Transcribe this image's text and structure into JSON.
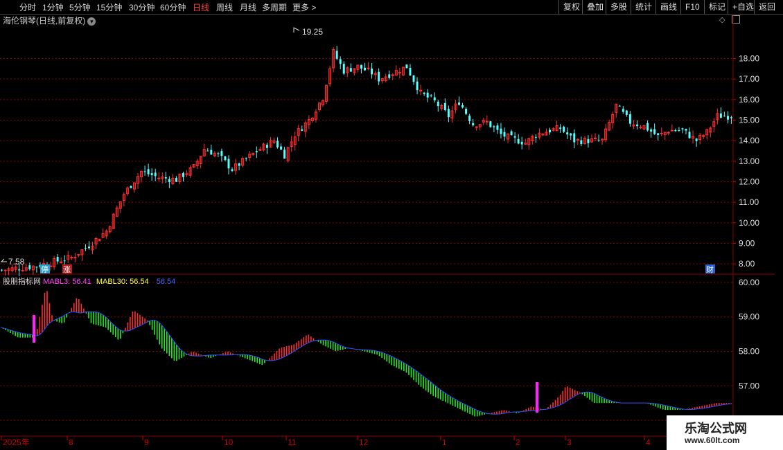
{
  "toolbar": {
    "periods": [
      "分时",
      "1分钟",
      "5分钟",
      "15分钟",
      "30分钟",
      "60分钟",
      "日线",
      "周线",
      "月线",
      "多周期",
      "更多"
    ],
    "active_period": "日线",
    "right_buttons": [
      "复权",
      "叠加",
      "多股",
      "统计",
      "画线",
      "F10",
      "标记",
      "+自选",
      "返回"
    ]
  },
  "chart": {
    "title": "海伦钢琴(日线,前复权)",
    "high_label": "19.25",
    "low_label": "7.58",
    "price_ticks": [
      "18.00",
      "17.00",
      "16.00",
      "15.00",
      "14.00",
      "13.00",
      "12.00",
      "11.00",
      "10.00",
      "9.00",
      "8.00"
    ],
    "markers": [
      "停",
      "涨",
      "财"
    ]
  },
  "indicator": {
    "name": "股朋指标网",
    "mabl3_label": "MABL3: 56.41",
    "mabl30_label": "MABL30: 56.54",
    "value_label": "56.54",
    "ticks": [
      "60.00",
      "59.00",
      "58.00",
      "57.00",
      "56.00"
    ]
  },
  "xaxis": {
    "labels": [
      "2025年",
      "8",
      "9",
      "10",
      "11",
      "12",
      "1",
      "2",
      "3",
      "4"
    ]
  },
  "watermark": {
    "line1": "乐淘公式网",
    "line2": "www.60lt.com"
  },
  "colors": {
    "up": "#ff3030",
    "down": "#54ffff",
    "mabl3": "#ff44ff",
    "mabl30": "#ffff44",
    "grid": "#8b0000",
    "green_bar": "#22ee22"
  },
  "chart_data": {
    "type": "candlestick+histogram",
    "price_ylim": [
      7.5,
      19.5
    ],
    "indicator_ylim": [
      55.9,
      60.2
    ],
    "close_path": [
      [
        0,
        7.7
      ],
      [
        10,
        7.9
      ],
      [
        20,
        8.3
      ],
      [
        25,
        8.9
      ],
      [
        30,
        9.6
      ],
      [
        35,
        11.4
      ],
      [
        40,
        12.5
      ],
      [
        45,
        12.2
      ],
      [
        50,
        12.1
      ],
      [
        55,
        12.7
      ],
      [
        58,
        13.6
      ],
      [
        62,
        13.3
      ],
      [
        66,
        12.6
      ],
      [
        70,
        13.1
      ],
      [
        74,
        13.6
      ],
      [
        78,
        14.0
      ],
      [
        81,
        13.3
      ],
      [
        84,
        14.3
      ],
      [
        88,
        15.0
      ],
      [
        92,
        16.1
      ],
      [
        95,
        18.3
      ],
      [
        98,
        17.4
      ],
      [
        102,
        17.6
      ],
      [
        106,
        17.3
      ],
      [
        108,
        17.0
      ],
      [
        112,
        17.3
      ],
      [
        116,
        17.6
      ],
      [
        120,
        16.3
      ],
      [
        124,
        15.9
      ],
      [
        128,
        15.2
      ],
      [
        131,
        15.9
      ],
      [
        135,
        14.8
      ],
      [
        139,
        14.9
      ],
      [
        143,
        14.3
      ],
      [
        146,
        14.1
      ],
      [
        150,
        13.9
      ],
      [
        153,
        14.3
      ],
      [
        157,
        14.5
      ],
      [
        160,
        14.6
      ],
      [
        164,
        14.0
      ],
      [
        168,
        14.0
      ],
      [
        172,
        14.0
      ],
      [
        176,
        15.7
      ],
      [
        180,
        14.9
      ],
      [
        184,
        14.7
      ],
      [
        188,
        14.2
      ],
      [
        191,
        14.5
      ],
      [
        195,
        14.5
      ],
      [
        199,
        14.0
      ],
      [
        202,
        14.4
      ],
      [
        205,
        15.2
      ]
    ],
    "indicator_bars": [
      [
        0,
        58.7
      ],
      [
        5,
        58.4
      ],
      [
        10,
        58.4
      ],
      [
        13,
        59.9
      ],
      [
        15,
        58.9
      ],
      [
        18,
        58.8
      ],
      [
        22,
        59.6
      ],
      [
        26,
        58.8
      ],
      [
        30,
        58.7
      ],
      [
        34,
        58.3
      ],
      [
        38,
        59.2
      ],
      [
        42,
        58.9
      ],
      [
        46,
        58.1
      ],
      [
        50,
        57.7
      ],
      [
        55,
        58.0
      ],
      [
        60,
        57.8
      ],
      [
        65,
        58.0
      ],
      [
        70,
        57.8
      ],
      [
        75,
        57.6
      ],
      [
        80,
        58.1
      ],
      [
        84,
        58.2
      ],
      [
        88,
        58.5
      ],
      [
        92,
        58.2
      ],
      [
        96,
        58.0
      ],
      [
        100,
        58.1
      ],
      [
        104,
        58.0
      ],
      [
        108,
        57.9
      ],
      [
        112,
        57.6
      ],
      [
        116,
        57.4
      ],
      [
        120,
        57.0
      ],
      [
        124,
        56.7
      ],
      [
        128,
        56.5
      ],
      [
        132,
        56.3
      ],
      [
        136,
        56.1
      ],
      [
        140,
        56.2
      ],
      [
        144,
        56.3
      ],
      [
        148,
        56.2
      ],
      [
        152,
        56.4
      ],
      [
        156,
        56.3
      ],
      [
        160,
        56.7
      ],
      [
        162,
        57.0
      ],
      [
        166,
        56.8
      ],
      [
        170,
        56.5
      ],
      [
        175,
        56.5
      ],
      [
        180,
        56.5
      ],
      [
        185,
        56.5
      ],
      [
        190,
        56.3
      ],
      [
        195,
        56.3
      ],
      [
        200,
        56.4
      ],
      [
        205,
        56.5
      ]
    ]
  }
}
